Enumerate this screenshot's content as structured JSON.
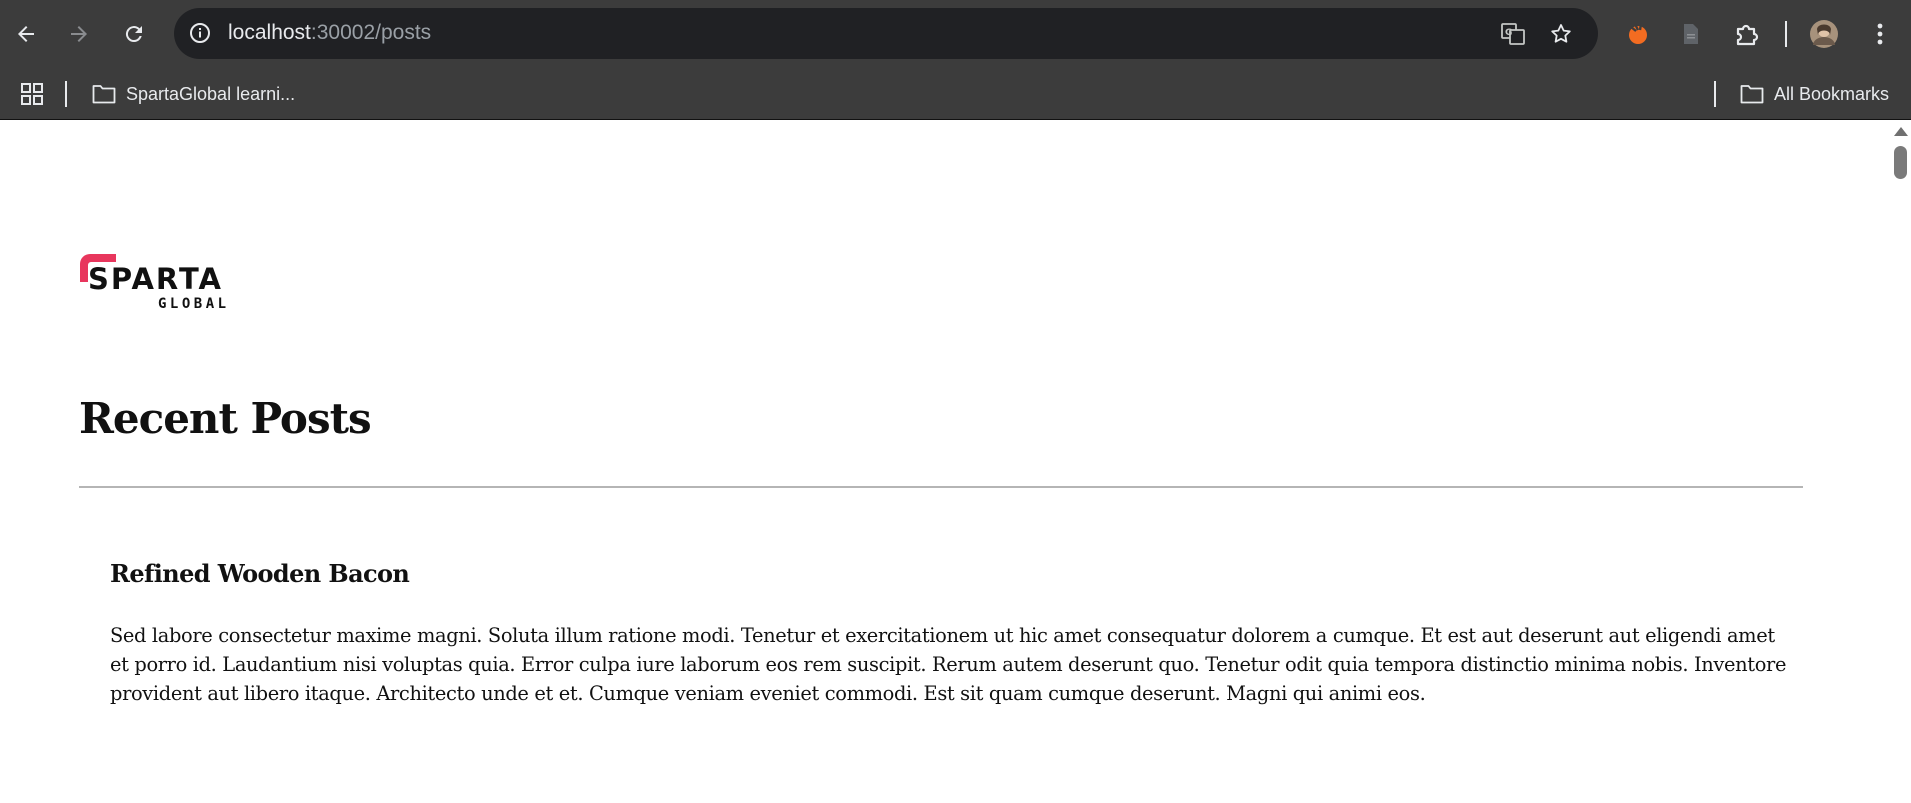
{
  "browser": {
    "url_host": "localhost",
    "url_rest": ":30002/posts",
    "bookmarks": {
      "folder_label": "SpartaGlobal learni...",
      "all_label": "All Bookmarks"
    },
    "colors": {
      "toolbar": "#3c3c3c",
      "omnibox": "#202124",
      "ext_accent": "#f36c21"
    },
    "icons": [
      "back-arrow-icon",
      "forward-arrow-icon",
      "reload-icon",
      "site-info-icon",
      "translate-icon",
      "bookmark-star-icon",
      "extension-icon",
      "document-icon",
      "extensions-puzzle-icon",
      "profile-avatar",
      "menu-kebab-icon",
      "apps-grid-icon",
      "folder-icon"
    ]
  },
  "page": {
    "logo": {
      "brand": "SPARTA",
      "tagline": "GLOBAL",
      "accent": "#e8365d"
    },
    "title": "Recent Posts",
    "posts": [
      {
        "title": "Refined Wooden Bacon",
        "body": "Sed labore consectetur maxime magni. Soluta illum ratione modi. Tenetur et exercitationem ut hic amet consequatur dolorem a cumque. Et est aut deserunt aut eligendi amet et porro id. Laudantium nisi voluptas quia. Error culpa iure laborum eos rem suscipit. Rerum autem deserunt quo. Tenetur odit quia tempora distinctio minima nobis. Inventore provident aut libero itaque. Architecto unde et et. Cumque veniam eveniet commodi. Est sit quam cumque deserunt. Magni qui animi eos."
      }
    ]
  }
}
